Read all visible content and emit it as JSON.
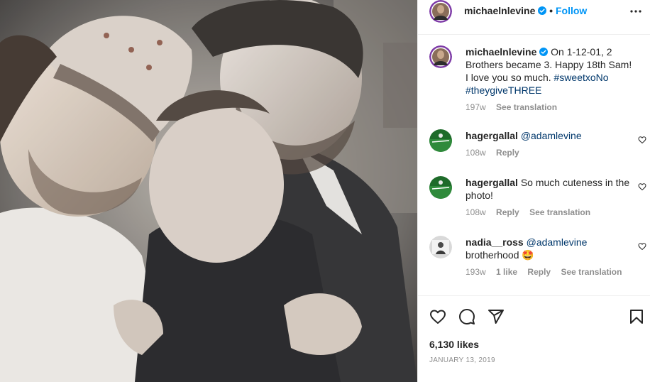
{
  "post": {
    "author": "michaelnlevine",
    "follow_label": "Follow",
    "separator": "•",
    "more_icon": "more-horizontal-icon",
    "caption": {
      "text_1": "On 1-12-01, 2 Brothers became 3. Happy 18th Sam! I love you so much.",
      "hashtag_1": "#sweetxoNo",
      "hashtag_2": "#theygiveTHREE",
      "age": "197w",
      "see_translation": "See translation"
    },
    "likes": "6,130 likes",
    "date": "JANUARY 13, 2019"
  },
  "comments": [
    {
      "user": "hagergallal",
      "mention": "@adamlevine",
      "text": "",
      "age": "108w",
      "likes": "",
      "reply": "Reply",
      "see_translation": ""
    },
    {
      "user": "hagergallal",
      "mention": "",
      "text": "So much cuteness in the photo!",
      "age": "108w",
      "likes": "",
      "reply": "Reply",
      "see_translation": "See translation"
    },
    {
      "user": "nadia__ross",
      "mention": "@adamlevine",
      "text": "brotherhood 🤩",
      "age": "193w",
      "likes": "1 like",
      "reply": "Reply",
      "see_translation": "See translation"
    }
  ],
  "icons": {
    "like": "heart-icon",
    "comment": "comment-icon",
    "share": "share-icon",
    "save": "bookmark-icon",
    "verified": "verified-badge-icon"
  },
  "colors": {
    "link": "#0095f6",
    "text": "#262626",
    "muted": "#8e8e8e",
    "hashtag": "#00376b"
  }
}
